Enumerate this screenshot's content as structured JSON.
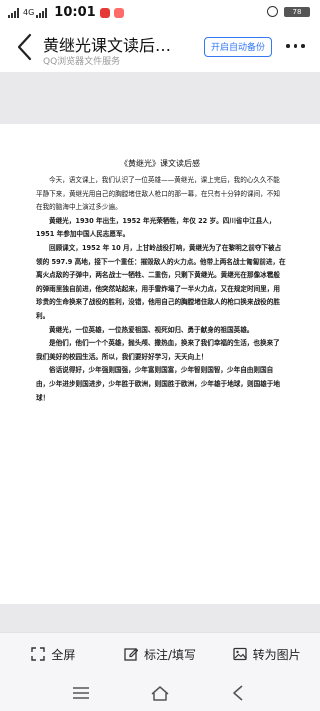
{
  "status": {
    "network": "4G",
    "time": "10:01",
    "battery": "78"
  },
  "header": {
    "title": "黄继光课文读后…",
    "subtitle": "QQ浏览器文件服务",
    "backup_label": "开启自动备份"
  },
  "document": {
    "title": "《黄继光》课文读后感",
    "paragraphs": [
      "今天，语文课上，我们认识了一位英雄——黄继光，课上完后，我的心久久不能平静下来，黄继光用自己的胸膛堵住敌人枪口的那一幕，在只有十分钟的课间，不知在我的脑海中上演过多少遍。",
      "黄继光，1930 年出生，1952 年光荣牺牲，年仅 22 岁。四川省中江县人，1951 年参加中国人民志愿军。",
      "回顾课文，1952 年 10 月，上甘岭战役打响，黄继光为了在黎明之前夺下被占领的 597.9 高地，接下一个重任：摧毁敌人的火力点。他带上两名战士匍匐前进，在离火点敌的子弹中，两名战士一牺牲、二重伤，只剩下黄继光。黄继光在那像冰雹般的弹雨里独自前进，他突然站起来，用手雷炸塌了一半火力点，又在规定时间里，用珍贵的生命换来了战役的胜利，没错，他用自己的胸膛堵住敌人的枪口换来战役的胜利。",
      "黄继光，一位英雄，一位热爱祖国、视死如归、勇于献身的祖国英雄。",
      "是他们，他们一个个英雄，抛头颅、撒热血，换来了我们幸福的生活，也换来了我们美好的校园生活。所以，我们要好好学习，天天向上！",
      "俗话说得好，少年强则国强，少年富则国富，少年智则国智，少年自由则国自由，少年进步则国进步，少年胜于欧洲，则国胜于欧洲，少年雄于地球，则国雄于地球！"
    ]
  },
  "toolbar": {
    "fullscreen": "全屏",
    "annotate": "标注/填写",
    "to_image": "转为图片"
  },
  "icons": {
    "back": "chevron-left-icon",
    "more": "more-dots-icon",
    "fullscreen": "expand-icon",
    "annotate": "edit-icon",
    "to_image": "image-icon",
    "nav_menu": "menu-icon",
    "nav_home": "home-icon",
    "nav_back": "back-icon"
  },
  "colors": {
    "accent": "#3478f6",
    "background": "#e9e9ec"
  }
}
